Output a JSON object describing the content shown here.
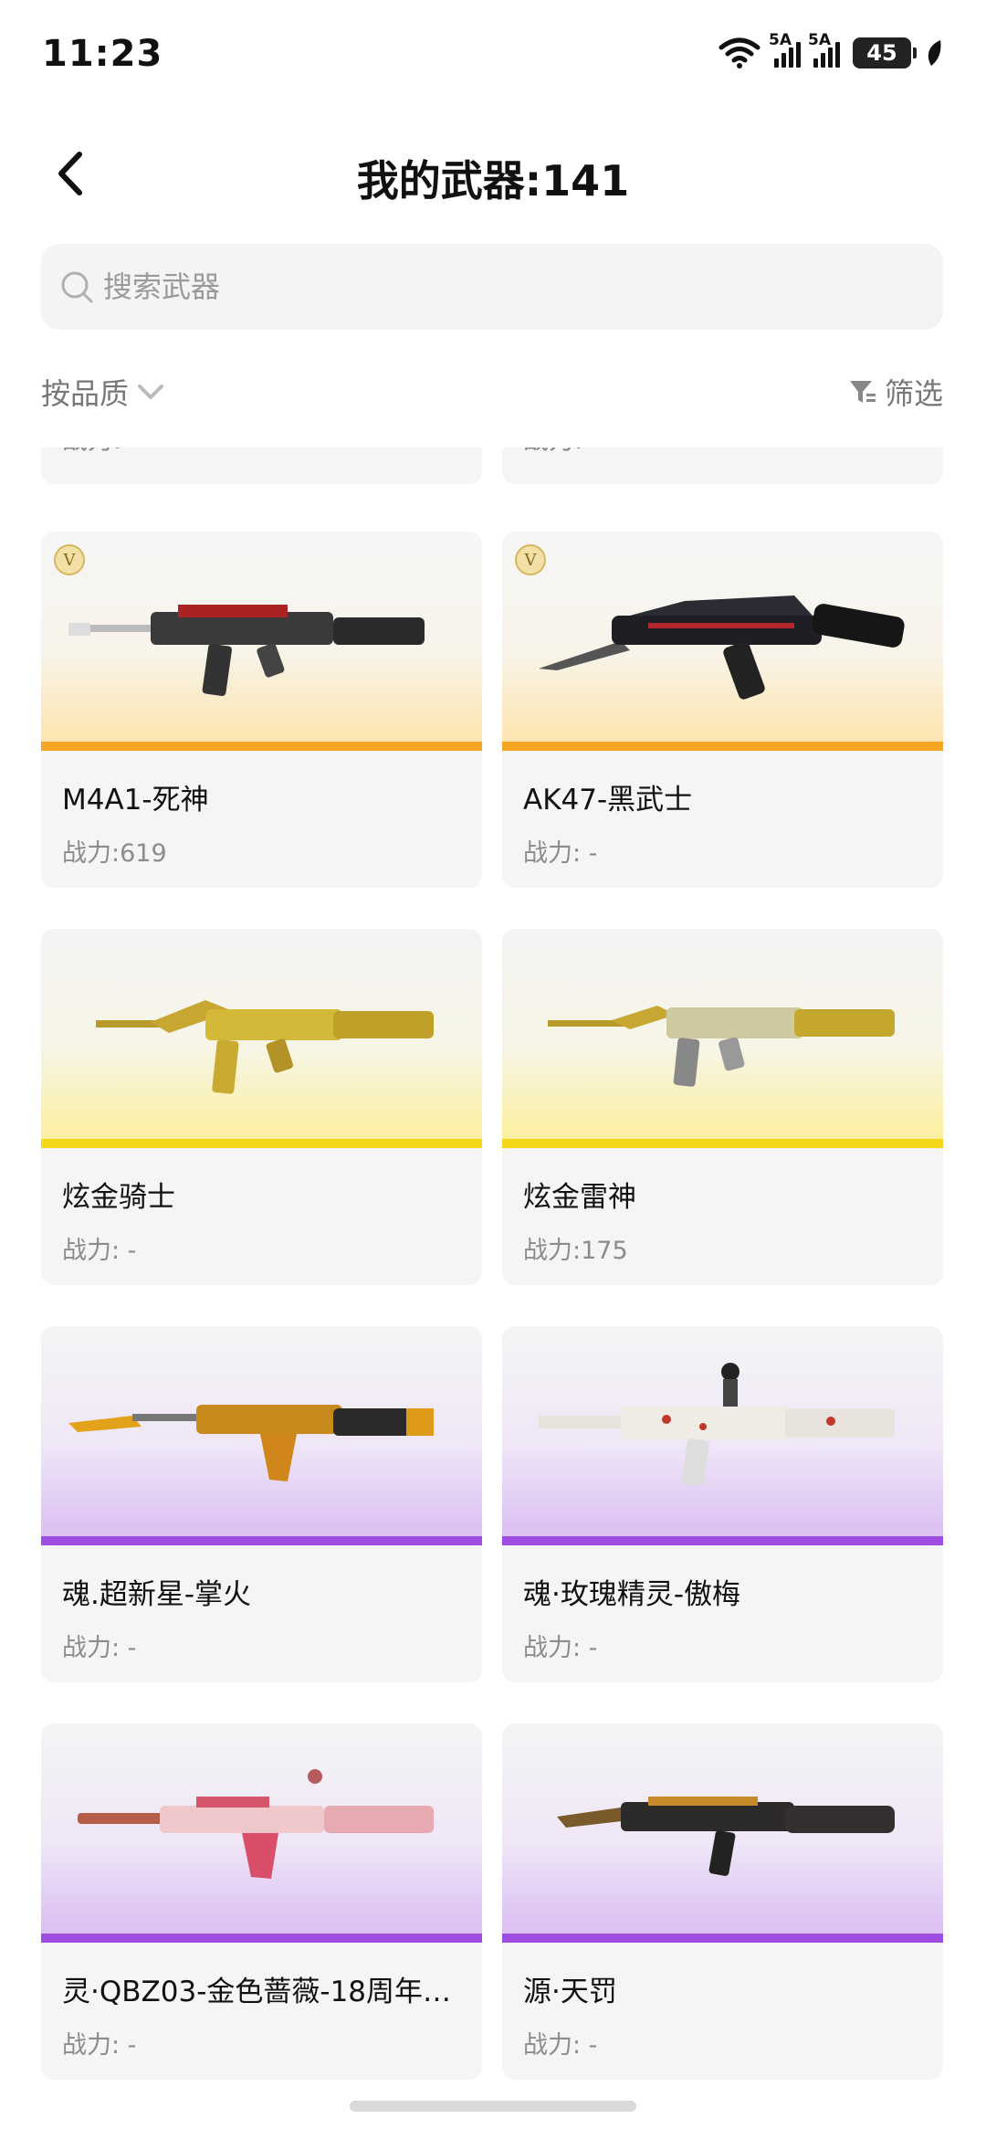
{
  "status_bar": {
    "time": "11:23",
    "battery": "45",
    "signal_label_1": "5A",
    "signal_label_2": "5A"
  },
  "header": {
    "title": "我的武器:141"
  },
  "search": {
    "placeholder": "搜索武器"
  },
  "filters": {
    "sort_label": "按品质",
    "filter_label": "筛选"
  },
  "partial_row": [
    {
      "stat": "战力: -"
    },
    {
      "stat": "战力: -"
    }
  ],
  "weapons": [
    {
      "name": "M4A1-死神",
      "stat": "战力:619",
      "rarity": "gold",
      "badge": "V"
    },
    {
      "name": "AK47-黑武士",
      "stat": "战力: -",
      "rarity": "gold",
      "badge": "V"
    },
    {
      "name": "炫金骑士",
      "stat": "战力: -",
      "rarity": "yellow"
    },
    {
      "name": "炫金雷神",
      "stat": "战力:175",
      "rarity": "yellow"
    },
    {
      "name": "魂.超新星-掌火",
      "stat": "战力: -",
      "rarity": "purple"
    },
    {
      "name": "魂·玫瑰精灵-傲梅",
      "stat": "战力: -",
      "rarity": "purple"
    },
    {
      "name": "灵·QBZ03-金色蔷薇-18周年…",
      "stat": "战力: -",
      "rarity": "purple"
    },
    {
      "name": "源·天罚",
      "stat": "战力: -",
      "rarity": "purple"
    }
  ],
  "colors": {
    "gold": "#f5a524",
    "yellow": "#f5d71a",
    "purple": "#9d4ee0"
  },
  "icons": [
    "wifi-icon",
    "signal-icon",
    "battery-icon",
    "leaf-icon",
    "back-arrow-icon",
    "search-icon",
    "chevron-down-icon",
    "filter-funnel-icon",
    "v-badge-icon"
  ]
}
